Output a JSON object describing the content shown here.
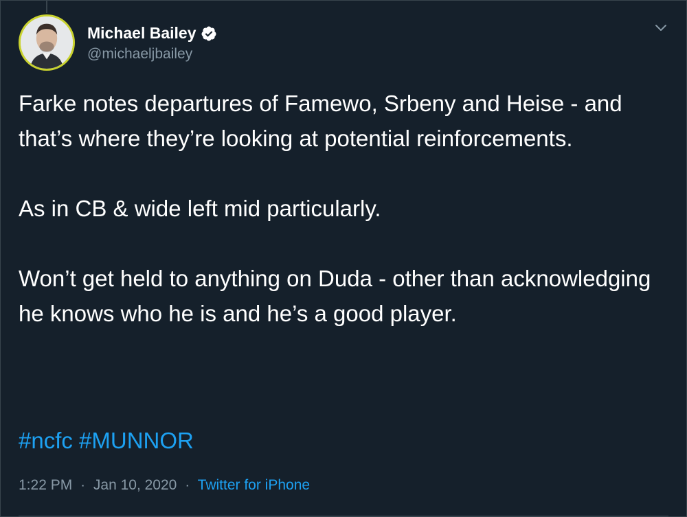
{
  "tweet": {
    "author": {
      "display_name": "Michael Bailey",
      "handle": "@michaeljbailey",
      "verified": true
    },
    "paragraphs": [
      "Farke notes departures of Famewo, Srbeny and Heise - and that’s where they’re looking at potential reinforcements.",
      "As in CB & wide left mid particularly.",
      "Won’t get held to anything on Duda - other than acknowledging he knows who he is and he’s a good player."
    ],
    "hashtags": [
      "#ncfc",
      "#MUNNOR"
    ],
    "time": "1:22 PM",
    "date": "Jan 10, 2020",
    "separator": "·",
    "source": "Twitter for iPhone"
  },
  "colors": {
    "background": "#15202b",
    "text": "#ffffff",
    "muted": "#8899a6",
    "link": "#1da1f2",
    "avatar_ring": "#c9d22e"
  },
  "icons": {
    "verified": "verified-badge-icon",
    "caret": "chevron-down-icon"
  }
}
